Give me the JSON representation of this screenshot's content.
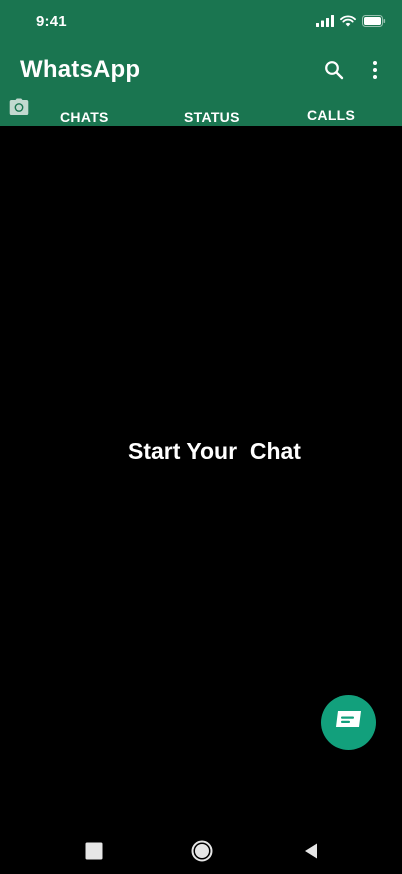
{
  "status_bar": {
    "time": "9:41",
    "signal_icon": "cellular-signal-icon",
    "wifi_icon": "wifi-icon",
    "battery_icon": "battery-icon"
  },
  "header": {
    "title": "WhatsApp",
    "search_icon": "search-icon",
    "menu_icon": "more-vertical-icon",
    "background_color": "#1a7550"
  },
  "tabs": [
    {
      "label": "",
      "icon": "camera-icon"
    },
    {
      "label": "CHATS"
    },
    {
      "label": "STATUS"
    },
    {
      "label": "CALLS"
    }
  ],
  "main": {
    "empty_state_text": "Start Your  Chat"
  },
  "fab": {
    "icon": "new-chat-icon",
    "color": "#12a07c"
  },
  "nav_bar": {
    "recents_icon": "square-icon",
    "home_icon": "circle-icon",
    "back_icon": "triangle-back-icon"
  }
}
